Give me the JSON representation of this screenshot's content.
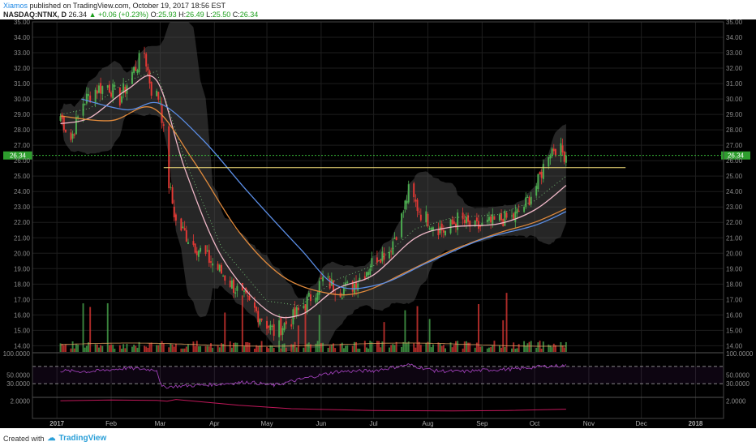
{
  "header": {
    "author": "Xiamos",
    "published_text": "published on TradingView.com, October 19, 2017 18:56 EST",
    "symbol": "NASDAQ:NTNX, D",
    "last": "26.34",
    "change_arrow": "▲",
    "change": "+0.06 (+0.23%)",
    "open_label": "O:",
    "open": "25.93",
    "high_label": "H:",
    "high": "26.49",
    "low_label": "L:",
    "low": "25.50",
    "close_label": "C:",
    "close": "26.34"
  },
  "footer": {
    "created_with": "Created with",
    "brand": "TradingView"
  },
  "colors": {
    "background": "#000000",
    "grid": "#1e1e1e",
    "up": "#4caf50",
    "down": "#e53935",
    "ma_fast": "#f0b8c8",
    "ma_mid": "#e08a3c",
    "ma_slow": "#5b8ee6",
    "band_fill": "#555555",
    "resistance": "#f5e07a",
    "price_line": "#3fd43f",
    "rsi": "#9c3fb5",
    "lower": "#c2185b"
  },
  "chart_data": {
    "type": "candlestick",
    "symbol": "NASDAQ:NTNX",
    "interval": "D",
    "y_ticks": [
      "14.00",
      "15.00",
      "16.00",
      "17.00",
      "18.00",
      "19.00",
      "20.00",
      "21.00",
      "22.00",
      "23.00",
      "24.00",
      "25.00",
      "26.00",
      "27.00",
      "28.00",
      "29.00",
      "30.00",
      "31.00",
      "32.00",
      "33.00",
      "34.00",
      "35.00"
    ],
    "ylim": [
      13.6,
      35.0
    ],
    "x_ticks": [
      "2017",
      "Feb",
      "Mar",
      "Apr",
      "May",
      "Jun",
      "Jul",
      "Aug",
      "Sep",
      "Oct",
      "Nov",
      "Dec",
      "2018"
    ],
    "last_price": 26.34,
    "last_price_label": "26.34",
    "resistance_level": 25.55,
    "price_path": [
      [
        "2017-01-03",
        28.9
      ],
      [
        "2017-01-09",
        27.4
      ],
      [
        "2017-01-16",
        29.8
      ],
      [
        "2017-01-23",
        30.6
      ],
      [
        "2017-01-30",
        30.9
      ],
      [
        "2017-02-06",
        30.0
      ],
      [
        "2017-02-13",
        31.7
      ],
      [
        "2017-02-20",
        33.0
      ],
      [
        "2017-02-24",
        30.6
      ],
      [
        "2017-03-01",
        30.0
      ],
      [
        "2017-03-06",
        24.5
      ],
      [
        "2017-03-10",
        22.0
      ],
      [
        "2017-03-20",
        20.6
      ],
      [
        "2017-04-03",
        19.0
      ],
      [
        "2017-04-17",
        17.2
      ],
      [
        "2017-04-28",
        15.8
      ],
      [
        "2017-05-05",
        14.9
      ],
      [
        "2017-05-15",
        15.7
      ],
      [
        "2017-05-25",
        17.0
      ],
      [
        "2017-06-02",
        18.3
      ],
      [
        "2017-06-12",
        17.6
      ],
      [
        "2017-06-19",
        17.9
      ],
      [
        "2017-06-26",
        18.8
      ],
      [
        "2017-07-03",
        19.8
      ],
      [
        "2017-07-10",
        20.2
      ],
      [
        "2017-07-17",
        22.3
      ],
      [
        "2017-07-21",
        24.0
      ],
      [
        "2017-07-28",
        22.6
      ],
      [
        "2017-08-04",
        21.9
      ],
      [
        "2017-08-11",
        21.4
      ],
      [
        "2017-08-18",
        22.2
      ],
      [
        "2017-08-28",
        21.6
      ],
      [
        "2017-09-05",
        21.9
      ],
      [
        "2017-09-12",
        22.2
      ],
      [
        "2017-09-19",
        22.3
      ],
      [
        "2017-09-26",
        23.2
      ],
      [
        "2017-10-03",
        24.6
      ],
      [
        "2017-10-09",
        26.6
      ],
      [
        "2017-10-13",
        26.9
      ],
      [
        "2017-10-19",
        26.34
      ]
    ],
    "moving_averages": [
      {
        "name": "MA fast",
        "color": "#f0b8c8",
        "points": [
          [
            "2017-01-03",
            28.4
          ],
          [
            "2017-01-20",
            28.8
          ],
          [
            "2017-02-10",
            30.6
          ],
          [
            "2017-02-27",
            31.2
          ],
          [
            "2017-03-15",
            25.5
          ],
          [
            "2017-04-05",
            19.8
          ],
          [
            "2017-05-01",
            16.3
          ],
          [
            "2017-05-20",
            16.0
          ],
          [
            "2017-06-10",
            17.7
          ],
          [
            "2017-07-01",
            18.6
          ],
          [
            "2017-07-25",
            21.0
          ],
          [
            "2017-08-15",
            21.7
          ],
          [
            "2017-09-10",
            21.9
          ],
          [
            "2017-10-01",
            22.8
          ],
          [
            "2017-10-19",
            24.4
          ]
        ]
      },
      {
        "name": "MA mid",
        "color": "#e08a3c",
        "points": [
          [
            "2017-01-03",
            28.9
          ],
          [
            "2017-02-01",
            28.6
          ],
          [
            "2017-02-25",
            29.4
          ],
          [
            "2017-03-20",
            26.0
          ],
          [
            "2017-04-15",
            21.4
          ],
          [
            "2017-05-10",
            18.5
          ],
          [
            "2017-06-05",
            17.4
          ],
          [
            "2017-06-25",
            17.5
          ],
          [
            "2017-07-20",
            18.8
          ],
          [
            "2017-08-15",
            20.2
          ],
          [
            "2017-09-10",
            21.3
          ],
          [
            "2017-10-01",
            22.0
          ],
          [
            "2017-10-19",
            22.9
          ]
        ]
      },
      {
        "name": "MA slow",
        "color": "#5b8ee6",
        "points": [
          [
            "2017-01-15",
            30.0
          ],
          [
            "2017-02-10",
            29.3
          ],
          [
            "2017-03-01",
            29.7
          ],
          [
            "2017-03-25",
            27.4
          ],
          [
            "2017-04-20",
            24.0
          ],
          [
            "2017-05-20",
            20.3
          ],
          [
            "2017-06-10",
            17.9
          ],
          [
            "2017-07-05",
            18.0
          ],
          [
            "2017-08-01",
            19.4
          ],
          [
            "2017-09-01",
            20.9
          ],
          [
            "2017-10-01",
            21.8
          ],
          [
            "2017-10-19",
            22.7
          ]
        ]
      }
    ],
    "rsi": {
      "levels": [
        "100.0000",
        "70",
        "50.0000",
        "30.0000"
      ],
      "level_values": [
        100,
        70,
        50,
        30
      ],
      "points": [
        [
          "2017-01-03",
          60
        ],
        [
          "2017-01-20",
          58
        ],
        [
          "2017-02-10",
          66
        ],
        [
          "2017-02-27",
          62
        ],
        [
          "2017-03-02",
          22
        ],
        [
          "2017-03-10",
          24
        ],
        [
          "2017-04-01",
          28
        ],
        [
          "2017-04-20",
          34
        ],
        [
          "2017-05-05",
          26
        ],
        [
          "2017-05-20",
          40
        ],
        [
          "2017-06-10",
          58
        ],
        [
          "2017-07-01",
          60
        ],
        [
          "2017-07-21",
          74
        ],
        [
          "2017-08-05",
          60
        ],
        [
          "2017-08-20",
          58
        ],
        [
          "2017-09-05",
          62
        ],
        [
          "2017-09-20",
          64
        ],
        [
          "2017-10-05",
          70
        ],
        [
          "2017-10-19",
          72
        ]
      ]
    },
    "lower_indicator": {
      "label": "2.0000",
      "points": [
        [
          "2017-01-03",
          2.0
        ],
        [
          "2017-02-01",
          2.1
        ],
        [
          "2017-02-27",
          2.05
        ],
        [
          "2017-03-05",
          1.95
        ],
        [
          "2017-03-10",
          2.15
        ],
        [
          "2017-04-15",
          1.5
        ],
        [
          "2017-05-15",
          1.1
        ],
        [
          "2017-07-01",
          0.9
        ],
        [
          "2017-08-15",
          0.85
        ],
        [
          "2017-09-15",
          0.9
        ],
        [
          "2017-10-19",
          1.05
        ]
      ]
    }
  }
}
